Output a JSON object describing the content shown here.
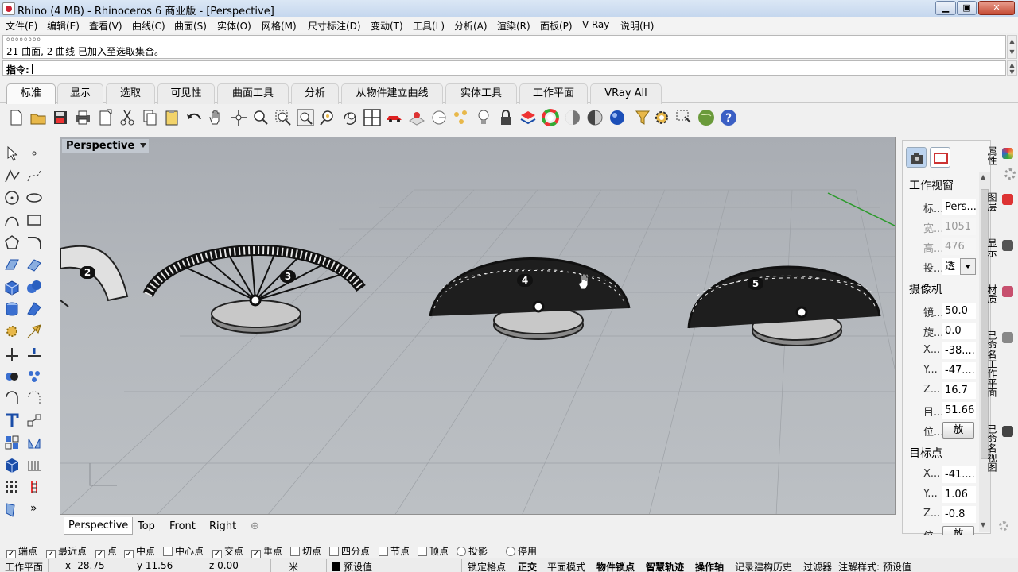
{
  "window": {
    "title": "Rhino (4 MB) - Rhinoceros 6 商业版 - [Perspective]",
    "min": "▁",
    "max": "▣",
    "close": "✕"
  },
  "menu": [
    "文件(F)",
    "编辑(E)",
    "查看(V)",
    "曲线(C)",
    "曲面(S)",
    "实体(O)",
    "网格(M)",
    "尺寸标注(D)",
    "变动(T)",
    "工具(L)",
    "分析(A)",
    "渲染(R)",
    "面板(P)",
    "V-Ray",
    "说明(H)"
  ],
  "command": {
    "history_prev": "。。。。。。。。",
    "history": "21 曲面, 2 曲线 已加入至选取集合。",
    "prompt": "指令:"
  },
  "toolbar_tabs": [
    "标准",
    "显示",
    "选取",
    "可见性",
    "曲面工具",
    "分析",
    "从物件建立曲线",
    "实体工具",
    "工作平面",
    "VRay All"
  ],
  "toolbar_icons": [
    "new-icon",
    "open-icon",
    "save-icon",
    "print-icon",
    "import-icon",
    "cut-icon",
    "copy-icon",
    "paste-icon",
    "undo-icon",
    "pan-icon",
    "move-view-icon",
    "zoom-icon",
    "zoom-window-icon",
    "zoom-extents-icon",
    "zoom-selected-icon",
    "rotate-view-icon",
    "four-viewports-icon",
    "car-icon",
    "grid-options-icon",
    "circle-options-icon",
    "points-icon",
    "light-icon",
    "lock-icon",
    "layer-icon",
    "color-wheel-icon",
    "shaded-sphere-icon",
    "rendered-sphere-icon",
    "blue-sphere-icon",
    "filter-icon",
    "settings-icon",
    "select-objects-icon",
    "globe-icon",
    "help-icon"
  ],
  "left_icons": [
    "select-arrow-icon",
    "point-icon",
    "polyline-icon",
    "curve-pts-icon",
    "circle-icon",
    "ellipse-icon",
    "arc-icon",
    "rectangle-icon",
    "polygon-icon",
    "fillet-icon",
    "surface-corner-icon",
    "extrude-surface-icon",
    "box-icon",
    "sphere-blob-icon",
    "cylinder-icon",
    "loft-icon",
    "explode-icon",
    "arrow-icon",
    "trim-icon",
    "split-icon",
    "boolean-icon",
    "group-icon",
    "rotate-icon",
    "scale-icon",
    "text-icon",
    "dimension-icon",
    "array-icon",
    "mirror-icon",
    "solid-box-icon",
    "grid-lines-icon",
    "pattern-icon",
    "stairs-icon",
    "brush-icon",
    "more-icon"
  ],
  "viewport": {
    "title": "Perspective",
    "labels": [
      "2",
      "3",
      "4",
      "5"
    ]
  },
  "viewport_tabs": [
    "Perspective",
    "Top",
    "Front",
    "Right"
  ],
  "viewport_tab_add": "⊕",
  "properties": {
    "section1": "工作视窗",
    "rows1": [
      {
        "k": "标...",
        "v": "Pers..."
      },
      {
        "k": "宽...",
        "v": "1051"
      },
      {
        "k": "高...",
        "v": "476"
      },
      {
        "k": "投...",
        "v": "透"
      }
    ],
    "section2": "摄像机",
    "rows2": [
      {
        "k": "镜...",
        "v": "50.0"
      },
      {
        "k": "旋...",
        "v": "0.0"
      },
      {
        "k": "X...",
        "v": "-38...."
      },
      {
        "k": "Y...",
        "v": "-47...."
      },
      {
        "k": "Z...",
        "v": "16.7"
      },
      {
        "k": "目...",
        "v": "51.66"
      },
      {
        "k": "位...",
        "v": "放置..."
      }
    ],
    "section3": "目标点",
    "rows3": [
      {
        "k": "X...",
        "v": "-41...."
      },
      {
        "k": "Y...",
        "v": "1.06"
      },
      {
        "k": "Z...",
        "v": "-0.8"
      },
      {
        "k": "位...",
        "v": "放置..."
      }
    ]
  },
  "side_tabs": [
    "属性",
    "图层",
    "显示",
    "材质",
    "已命名工作平面",
    "已命名视图"
  ],
  "osnaps": [
    {
      "label": "端点",
      "on": true
    },
    {
      "label": "最近点",
      "on": true
    },
    {
      "label": "点",
      "on": true
    },
    {
      "label": "中点",
      "on": true
    },
    {
      "label": "中心点",
      "on": false
    },
    {
      "label": "交点",
      "on": true
    },
    {
      "label": "垂点",
      "on": true
    },
    {
      "label": "切点",
      "on": false
    },
    {
      "label": "四分点",
      "on": false
    },
    {
      "label": "节点",
      "on": false
    },
    {
      "label": "顶点",
      "on": false
    },
    {
      "label": "投影",
      "on": false
    },
    {
      "label": "停用",
      "on": false
    }
  ],
  "status": {
    "cplane": "工作平面",
    "x": "x -28.75",
    "y": "y 11.56",
    "z": "z 0.00",
    "unit": "米",
    "layer": "预设值",
    "items": [
      "锁定格点",
      "正交",
      "平面模式",
      "物件锁点",
      "智慧轨迹",
      "操作轴",
      "记录建构历史",
      "过滤器"
    ],
    "bold": [
      false,
      true,
      false,
      true,
      true,
      true,
      false,
      false
    ],
    "style": "注解样式: 预设值"
  },
  "colors": {
    "accent_bg": "#f0f0f0",
    "viewport_bg": "#b0b4b9",
    "axis_green": "#2b9a2b"
  }
}
